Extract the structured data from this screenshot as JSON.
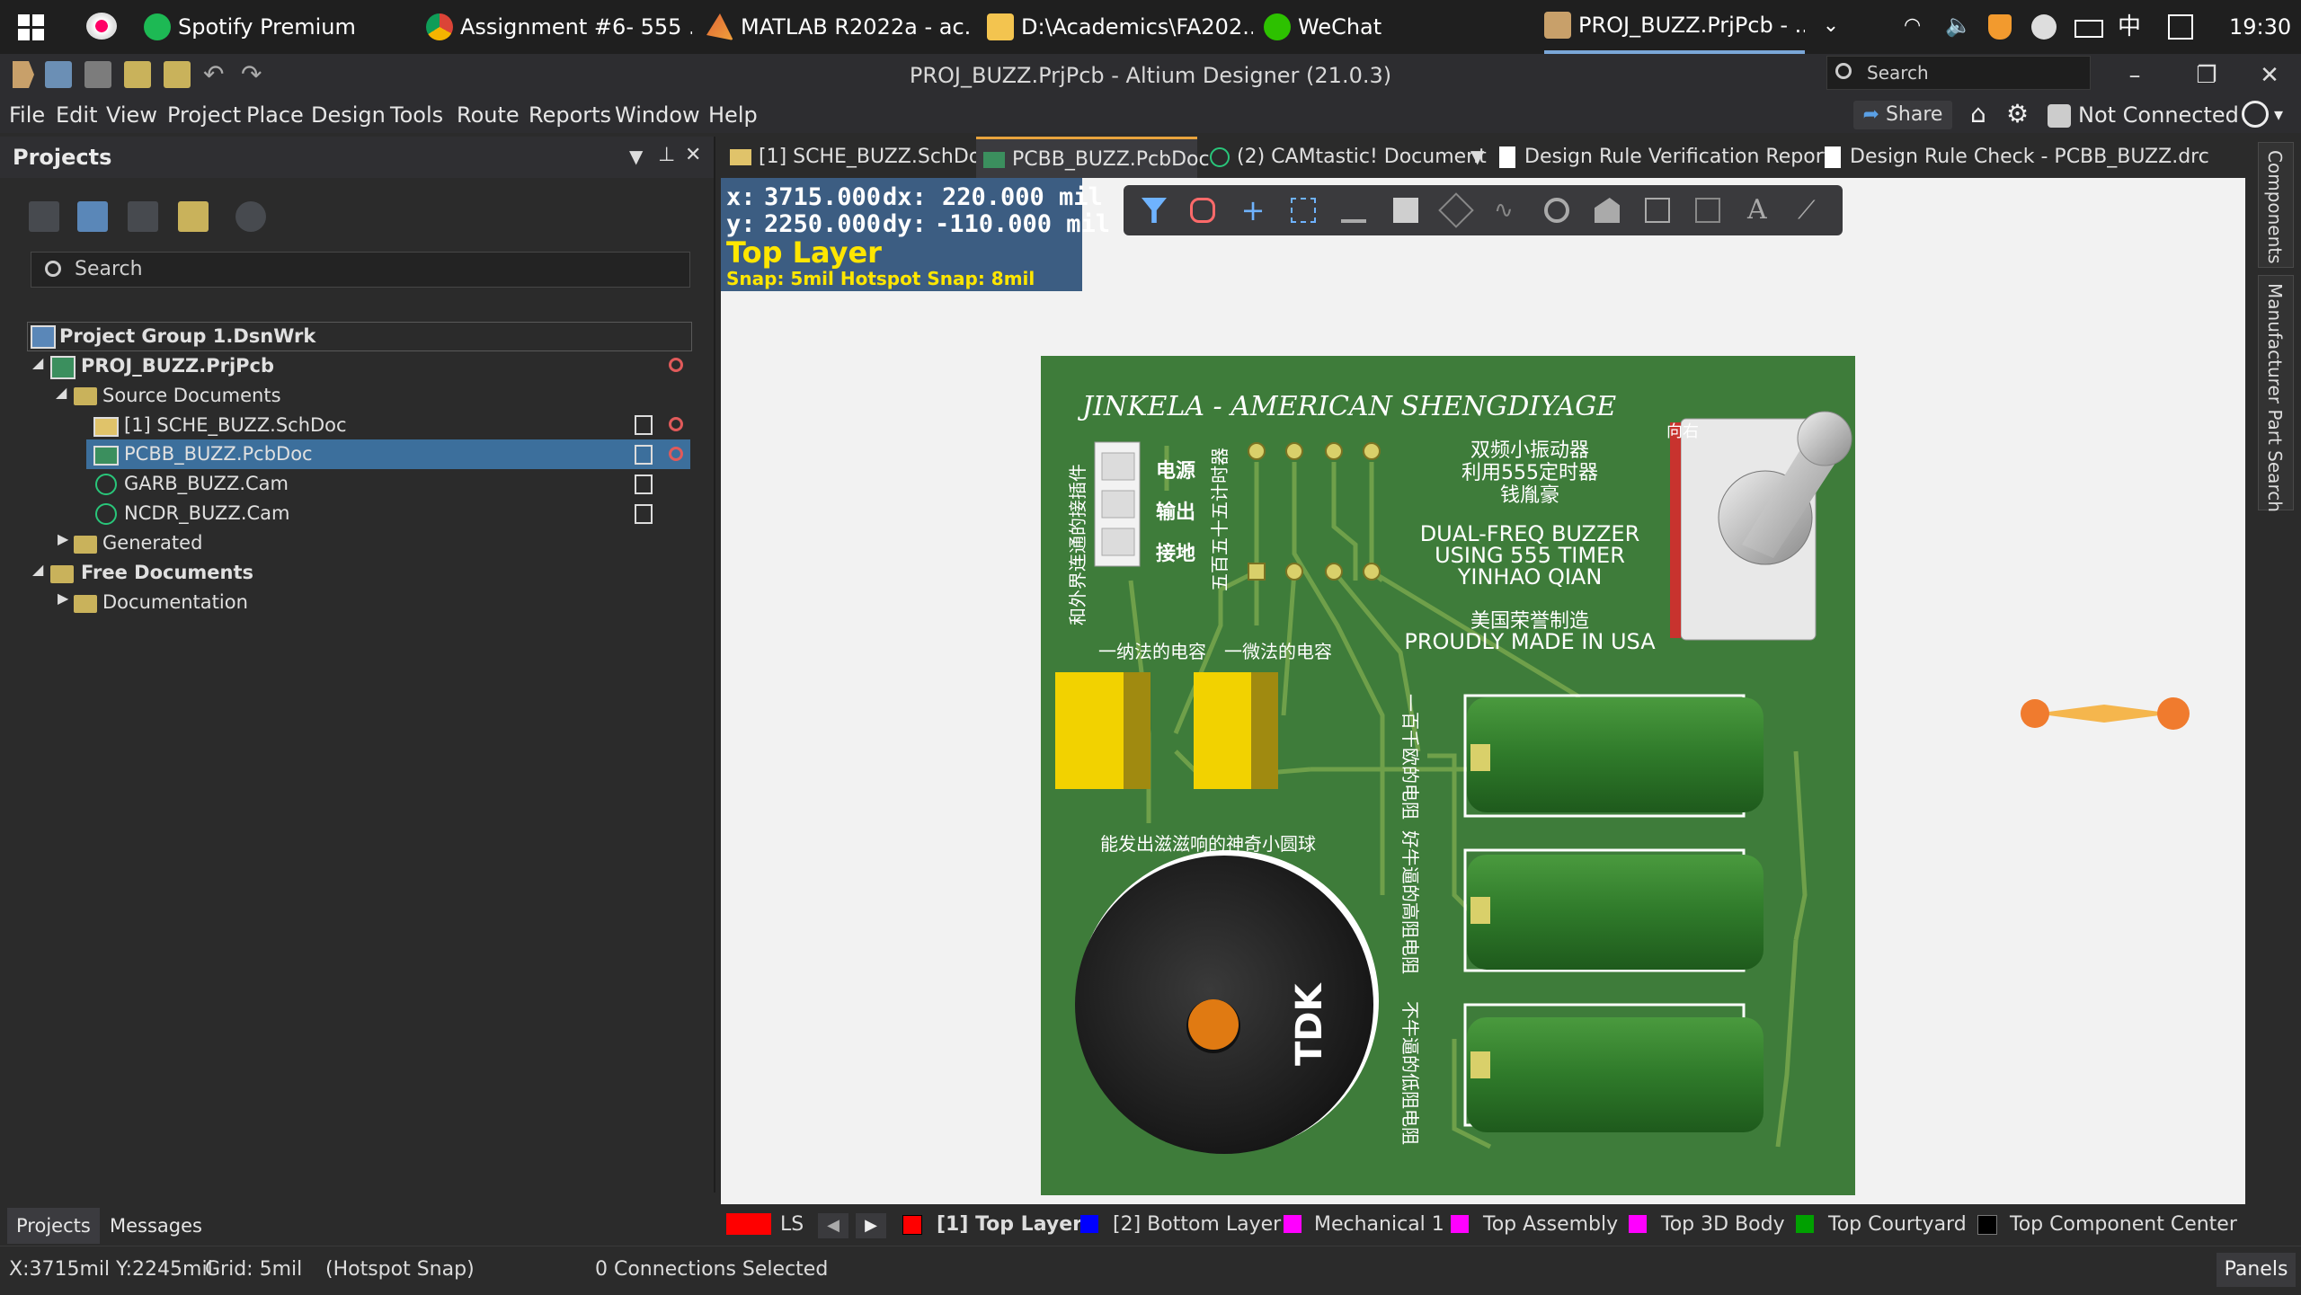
{
  "taskbar": {
    "items": [
      {
        "label": "Spotify Premium"
      },
      {
        "label": "Assignment #6- 555 ..."
      },
      {
        "label": "MATLAB R2022a - ac..."
      },
      {
        "label": "D:\\Academics\\FA202..."
      },
      {
        "label": "WeChat"
      },
      {
        "label": "PROJ_BUZZ.PrjPcb - ..."
      }
    ],
    "ime": "中",
    "clock": "19:30"
  },
  "window": {
    "title": "PROJ_BUZZ.PrjPcb - Altium Designer (21.0.3)",
    "search_placeholder": "Search"
  },
  "menu": [
    "File",
    "Edit",
    "View",
    "Project",
    "Place",
    "Design",
    "Tools",
    "Route",
    "Reports",
    "Window",
    "Help"
  ],
  "account": {
    "share_label": "Share",
    "connection": "Not Connected"
  },
  "projects_panel": {
    "title": "Projects",
    "search_placeholder": "Search",
    "tree": [
      {
        "label": "Project Group 1.DsnWrk"
      },
      {
        "label": "PROJ_BUZZ.PrjPcb"
      },
      {
        "label": "Source Documents"
      },
      {
        "label": "[1] SCHE_BUZZ.SchDoc"
      },
      {
        "label": "PCBB_BUZZ.PcbDoc"
      },
      {
        "label": "GARB_BUZZ.Cam"
      },
      {
        "label": "NCDR_BUZZ.Cam"
      },
      {
        "label": "Generated"
      },
      {
        "label": "Free Documents"
      },
      {
        "label": "Documentation"
      }
    ],
    "bottom_tabs": [
      "Projects",
      "Messages"
    ]
  },
  "doc_tabs": [
    {
      "label": "[1] SCHE_BUZZ.SchDoc"
    },
    {
      "label": "PCBB_BUZZ.PcbDoc"
    },
    {
      "label": "(2) CAMtastic! Document"
    },
    {
      "label": "Design Rule Verification Report"
    },
    {
      "label": "Design Rule Check - PCBB_BUZZ.drc"
    }
  ],
  "coords": {
    "x_label": "x:",
    "x": "3715.000",
    "dx_label": "dx:",
    "dx": "220.000 mil",
    "y_label": "y:",
    "y": "2250.000",
    "dy_label": "dy:",
    "dy": "-110.000 mil",
    "layer": "Top Layer",
    "snap": "Snap: 5mil Hotspot Snap: 8mil"
  },
  "right_panels": [
    "Components",
    "Manufacturer Part Search"
  ],
  "pcb": {
    "title": "JINKELA - AMERICAN SHENGDIYAGE",
    "cn_desc_1": "双频小振动器",
    "cn_desc_2": "利用555定时器",
    "cn_desc_3": "钱胤豪",
    "en_desc_1": "DUAL-FREQ BUZZER",
    "en_desc_2": "USING 555 TIMER",
    "en_desc_3": "YINHAO QIAN",
    "cn_made": "美国荣誉制造",
    "en_made": "PROUDLY MADE IN USA",
    "pin_power": "电源",
    "pin_out": "输出",
    "pin_gnd": "接地",
    "conn_label": "和外界连通的接插件",
    "ic_label": "五百五十五计时器",
    "switch_label": "向右",
    "cap1_label": "一纳法的电容",
    "cap2_label": "一微法的电容",
    "buzzer_label": "能发出滋滋响的神奇小圆球",
    "r1_label": "一百千欧的电阻",
    "r2_label": "好牛逼的高阻电阻",
    "r3_label": "不牛逼的低阻电阻",
    "buzzer_brand": "TDK"
  },
  "layers": [
    {
      "name": "LS",
      "color": "#ff0000"
    },
    {
      "name": "[1] Top Layer",
      "color": "#ff0000"
    },
    {
      "name": "[2] Bottom Layer",
      "color": "#0000ff"
    },
    {
      "name": "Mechanical 1",
      "color": "#ff00ff"
    },
    {
      "name": "Top Assembly",
      "color": "#ff00ff"
    },
    {
      "name": "Top 3D Body",
      "color": "#ff00ff"
    },
    {
      "name": "Top Courtyard",
      "color": "#00a000"
    },
    {
      "name": "Top Component Center",
      "color": "#000000"
    }
  ],
  "status": {
    "position": "X:3715mil Y:2245mil",
    "grid": "Grid: 5mil",
    "snap": "(Hotspot Snap)",
    "connections": "0 Connections Selected",
    "panels_button": "Panels"
  }
}
